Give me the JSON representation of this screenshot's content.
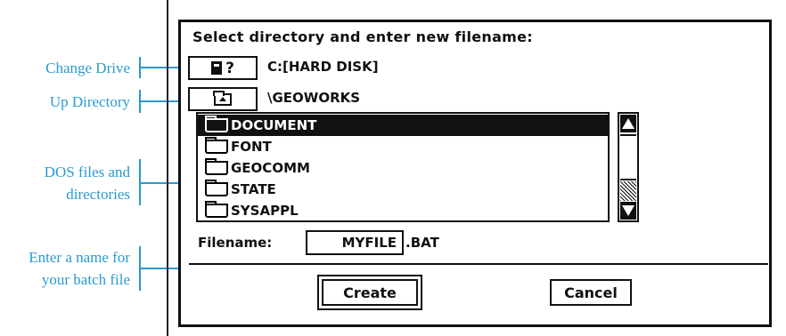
{
  "annotations": {
    "change_drive": "Change Drive",
    "up_directory": "Up Directory",
    "dos_files_line1": "DOS files and",
    "dos_files_line2": "directories",
    "enter_name_line1": "Enter a name for",
    "enter_name_line2": "your batch file",
    "color": "#2a9bd0"
  },
  "dialog": {
    "prompt": "Select directory and enter new filename:",
    "drive_button_label": "?",
    "drive_icon": "disk-drive-icon",
    "current_drive": "C:[HARD DISK]",
    "up_icon": "up-folder-icon",
    "current_directory": "\\GEOWORKS",
    "files": [
      {
        "name": "DOCUMENT",
        "selected": true,
        "icon": "folder-icon"
      },
      {
        "name": "FONT",
        "selected": false,
        "icon": "folder-icon"
      },
      {
        "name": "GEOCOMM",
        "selected": false,
        "icon": "folder-icon"
      },
      {
        "name": "STATE",
        "selected": false,
        "icon": "folder-icon"
      },
      {
        "name": "SYSAPPL",
        "selected": false,
        "icon": "folder-icon"
      }
    ],
    "filename_label": "Filename:",
    "filename_value": "MYFILE",
    "filename_extension": ".BAT",
    "create_label": "Create",
    "cancel_label": "Cancel"
  }
}
